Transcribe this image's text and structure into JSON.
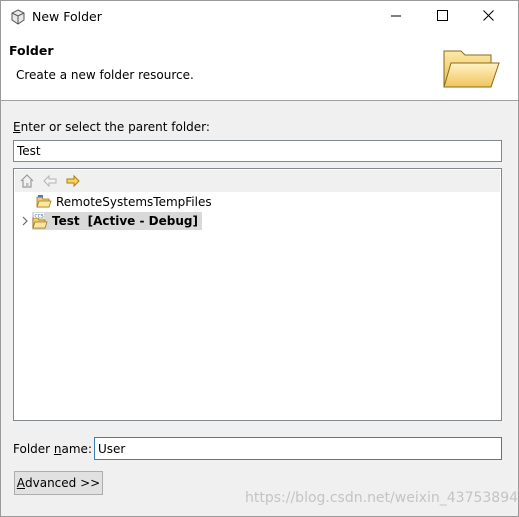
{
  "window": {
    "title": "New Folder",
    "icons": {
      "app": "eclipse-window-icon",
      "minimize": "minimize-icon",
      "maximize": "maximize-icon",
      "close": "close-icon"
    }
  },
  "banner": {
    "title": "Folder",
    "description": "Create a new folder resource.",
    "icon": "open-folder-icon"
  },
  "parent": {
    "label_mnemonic": "E",
    "label_rest": "nter or select the parent folder:",
    "value": "Test"
  },
  "tree": {
    "toolbar": {
      "home": "home-icon",
      "back": "back-arrow-icon",
      "forward": "forward-arrow-icon"
    },
    "items": [
      {
        "label": "RemoteSystemsTempFiles",
        "icon": "project-folder-icon",
        "expandable": false,
        "selected": false
      },
      {
        "name": "Test",
        "suffix": "[Active - Debug]",
        "icon": "ccs-project-icon",
        "expandable": true,
        "selected": true
      }
    ]
  },
  "folder_name": {
    "label_before": "Folder ",
    "label_mnemonic": "n",
    "label_after": "ame:",
    "value": "User"
  },
  "advanced_button": {
    "mnemonic": "A",
    "rest": "dvanced >>"
  },
  "watermark": "https://blog.csdn.net/weixin_43753894"
}
